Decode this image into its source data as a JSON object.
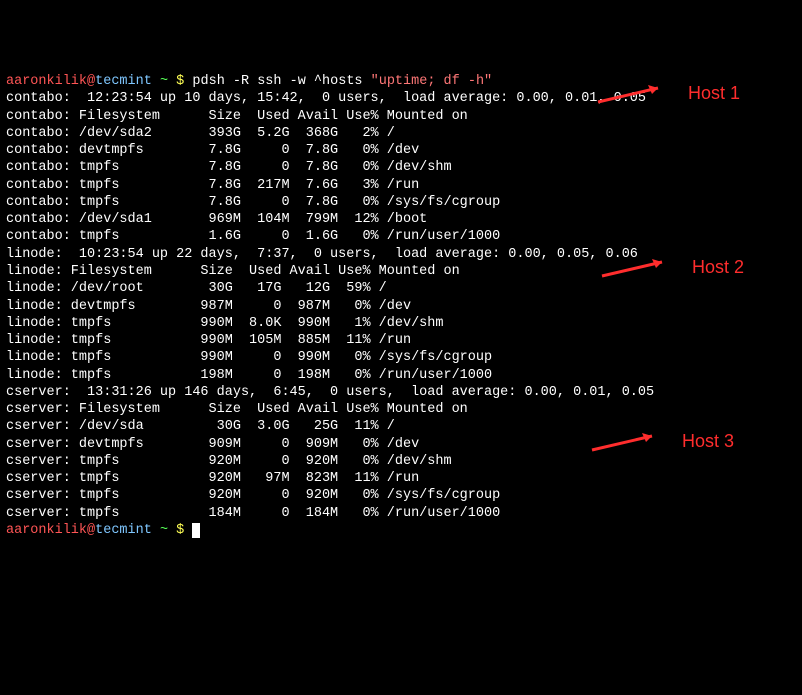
{
  "prompt": {
    "user": "aaronkilik",
    "host": "tecmint",
    "path": "~",
    "symbol": "$"
  },
  "command": {
    "bin": "pdsh -R ssh -w ^hosts ",
    "arg": "\"uptime; df -h\""
  },
  "annotations": {
    "h1": "Host 1",
    "h2": "Host 2",
    "h3": "Host 3"
  },
  "output": [
    "contabo:  12:23:54 up 10 days, 15:42,  0 users,  load average: 0.00, 0.01, 0.05",
    "contabo: Filesystem      Size  Used Avail Use% Mounted on",
    "contabo: /dev/sda2       393G  5.2G  368G   2% /",
    "contabo: devtmpfs        7.8G     0  7.8G   0% /dev",
    "contabo: tmpfs           7.8G     0  7.8G   0% /dev/shm",
    "contabo: tmpfs           7.8G  217M  7.6G   3% /run",
    "contabo: tmpfs           7.8G     0  7.8G   0% /sys/fs/cgroup",
    "contabo: /dev/sda1       969M  104M  799M  12% /boot",
    "contabo: tmpfs           1.6G     0  1.6G   0% /run/user/1000",
    "linode:  10:23:54 up 22 days,  7:37,  0 users,  load average: 0.00, 0.05, 0.06",
    "linode: Filesystem      Size  Used Avail Use% Mounted on",
    "linode: /dev/root        30G   17G   12G  59% /",
    "linode: devtmpfs        987M     0  987M   0% /dev",
    "linode: tmpfs           990M  8.0K  990M   1% /dev/shm",
    "linode: tmpfs           990M  105M  885M  11% /run",
    "linode: tmpfs           990M     0  990M   0% /sys/fs/cgroup",
    "linode: tmpfs           198M     0  198M   0% /run/user/1000",
    "cserver:  13:31:26 up 146 days,  6:45,  0 users,  load average: 0.00, 0.01, 0.05",
    "cserver: Filesystem      Size  Used Avail Use% Mounted on",
    "cserver: /dev/sda         30G  3.0G   25G  11% /",
    "cserver: devtmpfs        909M     0  909M   0% /dev",
    "cserver: tmpfs           920M     0  920M   0% /dev/shm",
    "cserver: tmpfs           920M   97M  823M  11% /run",
    "cserver: tmpfs           920M     0  920M   0% /sys/fs/cgroup",
    "cserver: tmpfs           184M     0  184M   0% /run/user/1000"
  ]
}
